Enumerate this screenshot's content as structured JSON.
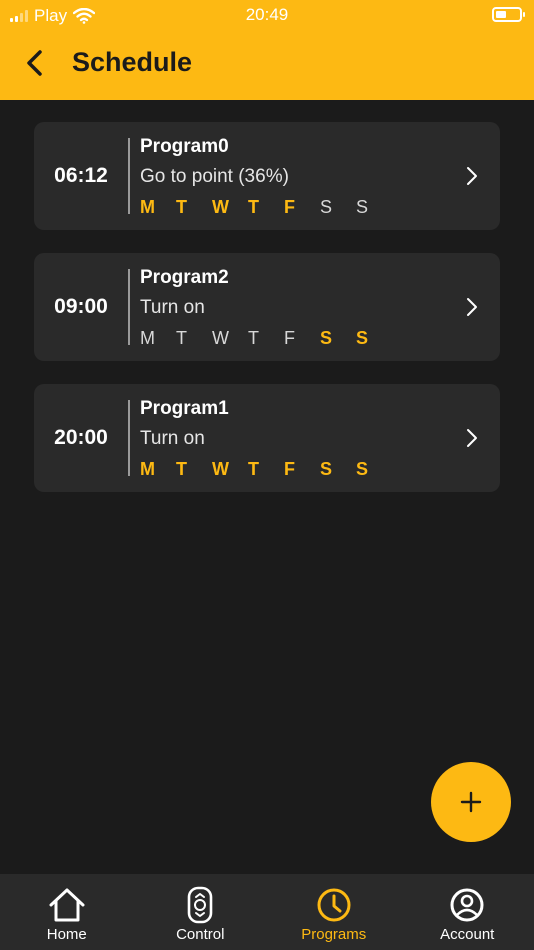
{
  "status_bar": {
    "carrier": "Play",
    "time": "20:49"
  },
  "header": {
    "title": "Schedule"
  },
  "programs": [
    {
      "time": "06:12",
      "name": "Program0",
      "action": "Go to point (36%)",
      "days": [
        {
          "label": "M",
          "active": true
        },
        {
          "label": "T",
          "active": true
        },
        {
          "label": "W",
          "active": true
        },
        {
          "label": "T",
          "active": true
        },
        {
          "label": "F",
          "active": true
        },
        {
          "label": "S",
          "active": false
        },
        {
          "label": "S",
          "active": false
        }
      ]
    },
    {
      "time": "09:00",
      "name": "Program2",
      "action": "Turn on",
      "days": [
        {
          "label": "M",
          "active": false
        },
        {
          "label": "T",
          "active": false
        },
        {
          "label": "W",
          "active": false
        },
        {
          "label": "T",
          "active": false
        },
        {
          "label": "F",
          "active": false
        },
        {
          "label": "S",
          "active": true
        },
        {
          "label": "S",
          "active": true
        }
      ]
    },
    {
      "time": "20:00",
      "name": "Program1",
      "action": "Turn on",
      "days": [
        {
          "label": "M",
          "active": true
        },
        {
          "label": "T",
          "active": true
        },
        {
          "label": "W",
          "active": true
        },
        {
          "label": "T",
          "active": true
        },
        {
          "label": "F",
          "active": true
        },
        {
          "label": "S",
          "active": true
        },
        {
          "label": "S",
          "active": true
        }
      ]
    }
  ],
  "fab": {
    "icon": "plus-icon"
  },
  "nav": {
    "items": [
      {
        "label": "Home",
        "icon": "home-icon",
        "active": false
      },
      {
        "label": "Control",
        "icon": "remote-control-icon",
        "active": false
      },
      {
        "label": "Programs",
        "icon": "clock-icon",
        "active": true
      },
      {
        "label": "Account",
        "icon": "account-icon",
        "active": false
      }
    ]
  },
  "colors": {
    "accent": "#fdb913",
    "background": "#1b1b1b",
    "card": "#2a2a2a"
  }
}
